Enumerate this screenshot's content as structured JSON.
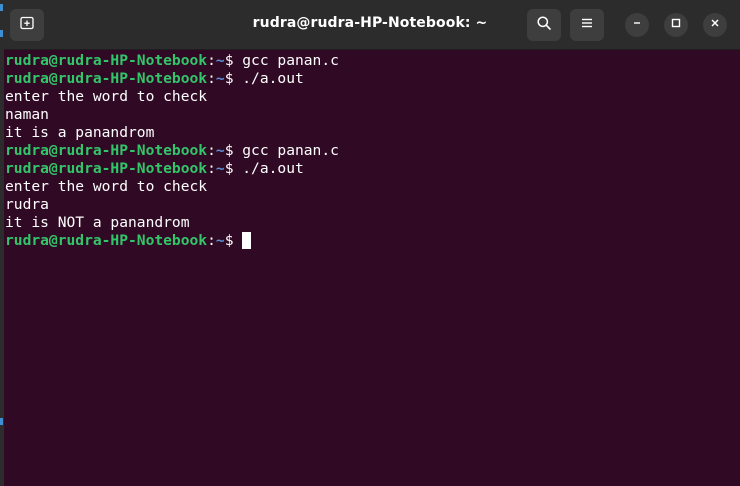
{
  "window": {
    "title": "rudra@rudra-HP-Notebook: ~"
  },
  "titlebar": {
    "new_tab_icon": "new-tab-icon",
    "search_icon": "search-icon",
    "menu_icon": "hamburger-menu-icon",
    "minimize_icon": "minimize-icon",
    "maximize_icon": "maximize-icon",
    "close_icon": "close-icon"
  },
  "terminal": {
    "prompt_user": "rudra@rudra-HP-Notebook",
    "prompt_colon": ":",
    "prompt_path": "~",
    "prompt_dollar": "$ ",
    "lines": [
      {
        "type": "prompt",
        "command": "gcc panan.c"
      },
      {
        "type": "prompt",
        "command": "./a.out"
      },
      {
        "type": "output",
        "text": "enter the word to check"
      },
      {
        "type": "output",
        "text": "naman"
      },
      {
        "type": "output",
        "text": "it is a panandrom"
      },
      {
        "type": "prompt",
        "command": "gcc panan.c"
      },
      {
        "type": "prompt",
        "command": "./a.out"
      },
      {
        "type": "output",
        "text": "enter the word to check"
      },
      {
        "type": "output",
        "text": "rudra"
      },
      {
        "type": "output",
        "text": "it is NOT a panandrom"
      },
      {
        "type": "prompt",
        "command": ""
      }
    ]
  },
  "colors": {
    "background": "#300a24",
    "prompt_user": "#33c56a",
    "prompt_path": "#5a8fd6",
    "text": "#ffffff",
    "titlebar": "#2c2c2c"
  }
}
